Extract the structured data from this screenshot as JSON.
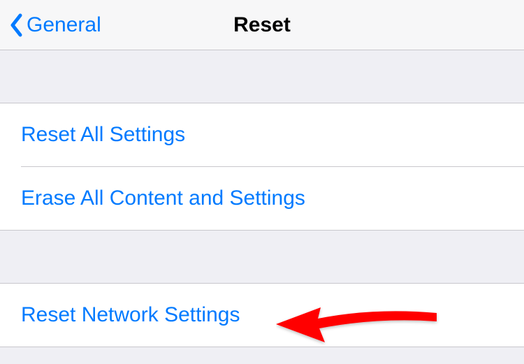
{
  "nav": {
    "back_label": "General",
    "title": "Reset"
  },
  "sections": [
    {
      "items": [
        {
          "label": "Reset All Settings"
        },
        {
          "label": "Erase All Content and Settings"
        }
      ]
    },
    {
      "items": [
        {
          "label": "Reset Network Settings"
        }
      ]
    }
  ]
}
